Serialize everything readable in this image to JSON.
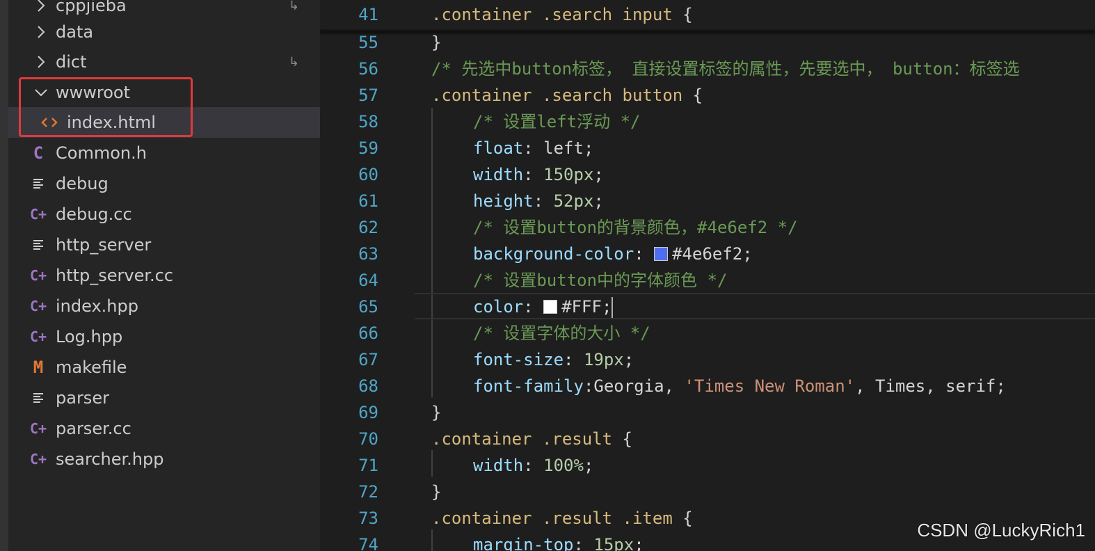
{
  "sidebar": {
    "items": [
      {
        "label": "cppjieba",
        "type": "folder",
        "state": "collapsed",
        "icon": "chevron-right-icon"
      },
      {
        "label": "data",
        "type": "folder",
        "state": "collapsed",
        "icon": "chevron-right-icon"
      },
      {
        "label": "dict",
        "type": "folder",
        "state": "collapsed",
        "icon": "chevron-right-icon"
      },
      {
        "label": "wwwroot",
        "type": "folder",
        "state": "expanded",
        "icon": "chevron-down-icon"
      },
      {
        "label": "index.html",
        "type": "file",
        "icon": "html-file-icon",
        "selected": true
      },
      {
        "label": "Common.h",
        "type": "file",
        "icon": "c-file-icon",
        "glyph": "C"
      },
      {
        "label": "debug",
        "type": "file",
        "icon": "text-file-icon"
      },
      {
        "label": "debug.cc",
        "type": "file",
        "icon": "cpp-file-icon",
        "glyph": "C+"
      },
      {
        "label": "http_server",
        "type": "file",
        "icon": "text-file-icon"
      },
      {
        "label": "http_server.cc",
        "type": "file",
        "icon": "cpp-file-icon",
        "glyph": "C+"
      },
      {
        "label": "index.hpp",
        "type": "file",
        "icon": "cpp-file-icon",
        "glyph": "C+"
      },
      {
        "label": "Log.hpp",
        "type": "file",
        "icon": "cpp-file-icon",
        "glyph": "C+"
      },
      {
        "label": "makefile",
        "type": "file",
        "icon": "makefile-icon",
        "glyph": "M"
      },
      {
        "label": "parser",
        "type": "file",
        "icon": "text-file-icon"
      },
      {
        "label": "parser.cc",
        "type": "file",
        "icon": "cpp-file-icon",
        "glyph": "C+"
      },
      {
        "label": "searcher.hpp",
        "type": "file",
        "icon": "cpp-file-icon",
        "glyph": "C+"
      }
    ]
  },
  "editor": {
    "sticky": {
      "line": "41",
      "selector": ".container .search input",
      "open": " {"
    },
    "lines": [
      {
        "n": "55",
        "close": "}"
      },
      {
        "n": "56",
        "comment": "/* 先选中button标签， 直接设置标签的属性，先要选中， button：标签选"
      },
      {
        "n": "57",
        "selector": ".container .search button",
        "open": " {"
      },
      {
        "n": "58",
        "comment": "/* 设置left浮动 */"
      },
      {
        "n": "59",
        "prop": "float",
        "value": "left",
        "semi": ";"
      },
      {
        "n": "60",
        "prop": "width",
        "num": "150px",
        "semi": ";"
      },
      {
        "n": "61",
        "prop": "height",
        "num": "52px",
        "semi": ";"
      },
      {
        "n": "62",
        "comment": "/* 设置button的背景颜色，#4e6ef2 */"
      },
      {
        "n": "63",
        "prop": "background-color",
        "value": "#4e6ef2",
        "semi": ";",
        "swatch": "#4e6ef2"
      },
      {
        "n": "64",
        "comment": "/* 设置button中的字体颜色 */"
      },
      {
        "n": "65",
        "prop": "color",
        "value": "#FFF",
        "semi": ";",
        "swatch": "#ffffff"
      },
      {
        "n": "66",
        "comment": "/* 设置字体的大小 */"
      },
      {
        "n": "67",
        "prop": "font-size",
        "num": "19px",
        "semi": ";"
      },
      {
        "n": "68",
        "prop": "font-family",
        "value1": "Georgia, ",
        "str": "'Times New Roman'",
        "value2": ", Times, serif",
        "semi": ";"
      },
      {
        "n": "69",
        "close": "}"
      },
      {
        "n": "70",
        "selector": ".container .result",
        "open": " {"
      },
      {
        "n": "71",
        "prop": "width",
        "num": "100%",
        "semi": ";"
      },
      {
        "n": "72",
        "close": "}"
      },
      {
        "n": "73",
        "selector": ".container .result .item",
        "open": " {"
      },
      {
        "n": "74",
        "prop": "margin-top",
        "num": "15px",
        "semi": ";"
      }
    ]
  },
  "watermark": "CSDN @LuckyRich1",
  "colors": {
    "highlight_box": "#e03a3a",
    "line_number": "#4fa6c8",
    "selector": "#d7ba7d",
    "property": "#9cdcfe",
    "number": "#b5cea8",
    "string": "#ce9178",
    "comment": "#6a9955"
  }
}
